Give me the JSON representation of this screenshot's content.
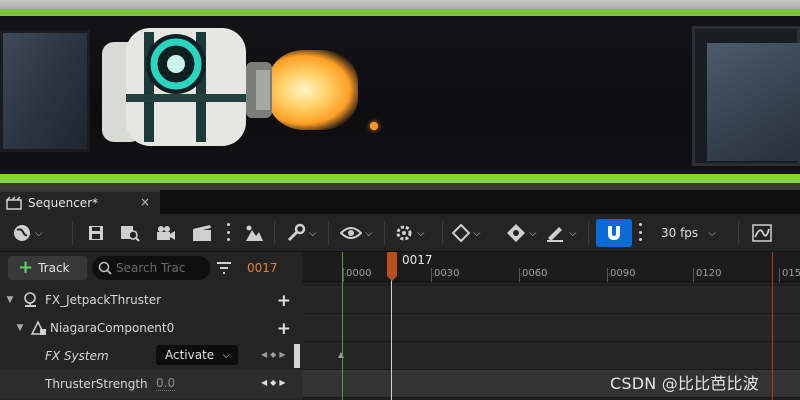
{
  "tab": {
    "title": "Sequencer*",
    "close": "×"
  },
  "toolbar": {
    "fps": "30 fps",
    "icons": [
      "world-icon",
      "save-icon",
      "find-asset-icon",
      "camera-icon",
      "render-icon",
      "playback-icon",
      "wrench-icon",
      "eye-icon",
      "gear-icon",
      "keyframe-icon",
      "key-icon",
      "pencil-icon",
      "magnet-icon",
      "curve-editor-icon"
    ],
    "accent_color": "#0b6bd6"
  },
  "left": {
    "add_track_label": "Track",
    "search_placeholder": "Search Trac",
    "current_frame": "0017",
    "rows": [
      {
        "label": "FX_JetpackThruster"
      },
      {
        "label": "NiagaraComponent0"
      },
      {
        "label": "FX System",
        "dropdown": "Activate"
      },
      {
        "label": "ThrusterStrength",
        "value": "0.0"
      }
    ]
  },
  "timeline": {
    "playhead_label": "0017",
    "ticks": [
      "0000",
      "0030",
      "0060",
      "0090",
      "0120",
      "015"
    ],
    "start_color": "#4aa62e",
    "end_color": "#b03a1a",
    "playhead_color": "#b5521d"
  },
  "watermark": "CSDN @比比芭比波"
}
